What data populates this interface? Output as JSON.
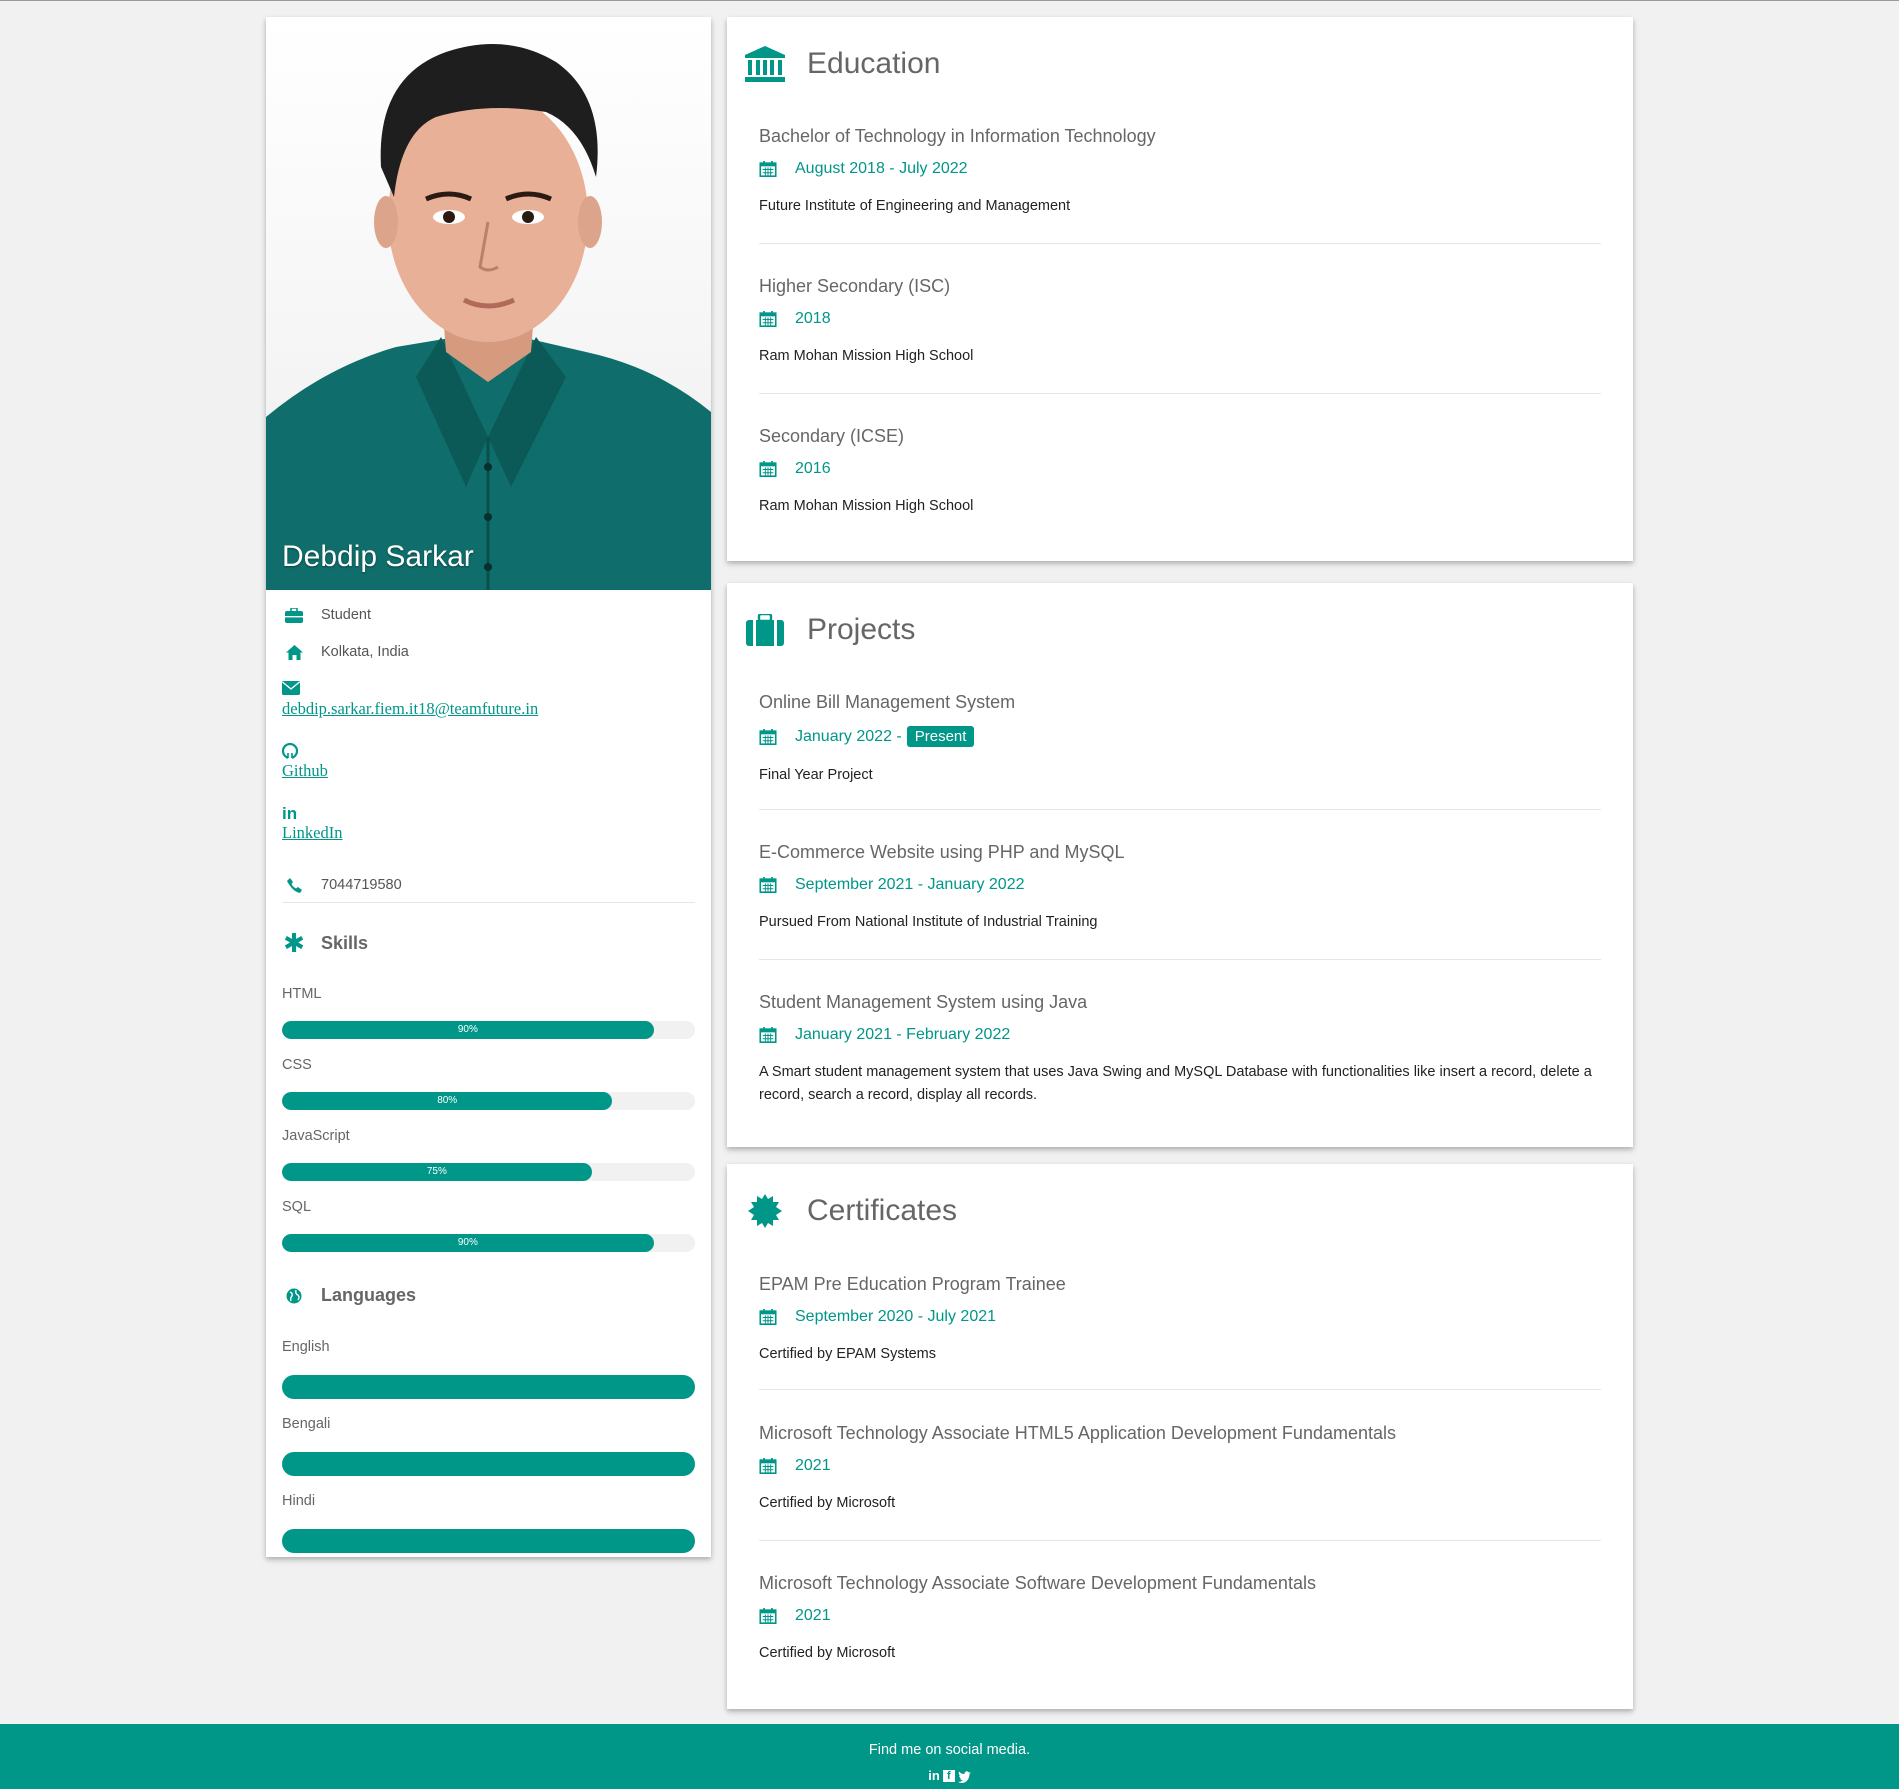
{
  "profile": {
    "name": "Debdip Sarkar",
    "role": "Student",
    "location": "Kolkata, India",
    "email": "debdip.sarkar.fiem.it18@teamfuture.in",
    "github": "Github",
    "linkedin": "LinkedIn",
    "phone": "7044719580"
  },
  "skills": {
    "heading": "Skills",
    "items": [
      {
        "name": "HTML",
        "percent": 90,
        "label": "90%"
      },
      {
        "name": "CSS",
        "percent": 80,
        "label": "80%"
      },
      {
        "name": "JavaScript",
        "percent": 75,
        "label": "75%"
      },
      {
        "name": "SQL",
        "percent": 90,
        "label": "90%"
      }
    ]
  },
  "languages": {
    "heading": "Languages",
    "items": [
      {
        "name": "English",
        "percent": 100
      },
      {
        "name": "Bengali",
        "percent": 100
      },
      {
        "name": "Hindi",
        "percent": 100
      }
    ]
  },
  "education": {
    "heading": "Education",
    "entries": [
      {
        "title": "Bachelor of Technology in Information Technology",
        "date": "August 2018 - July 2022",
        "desc": "Future Institute of Engineering and Management"
      },
      {
        "title": "Higher Secondary (ISC)",
        "date": "2018",
        "desc": "Ram Mohan Mission High School"
      },
      {
        "title": "Secondary (ICSE)",
        "date": "2016",
        "desc": "Ram Mohan Mission High School"
      }
    ]
  },
  "projects": {
    "heading": "Projects",
    "entries": [
      {
        "title": "Online Bill Management System",
        "date": "January 2022 -",
        "badge": "Present",
        "desc": "Final Year Project"
      },
      {
        "title": "E-Commerce Website using PHP and MySQL",
        "date": "September 2021 - January 2022",
        "desc": "Pursued From National Institute of Industrial Training"
      },
      {
        "title": "Student Management System using Java",
        "date": "January 2021 - February 2022",
        "desc": "A Smart student management system that uses Java Swing and MySQL Database with functionalities like insert a record, delete a record, search a record, display all records."
      }
    ]
  },
  "certificates": {
    "heading": "Certificates",
    "entries": [
      {
        "title": "EPAM Pre Education Program Trainee",
        "date": "September 2020 - July 2021",
        "desc": "Certified by EPAM Systems"
      },
      {
        "title": "Microsoft Technology Associate HTML5 Application Development Fundamentals",
        "date": "2021",
        "desc": "Certified by Microsoft"
      },
      {
        "title": "Microsoft Technology Associate Software Development Fundamentals",
        "date": "2021",
        "desc": "Certified by Microsoft"
      }
    ]
  },
  "footer": {
    "text": "Find me on social media.",
    "icons": [
      "linkedin-icon",
      "facebook-icon",
      "twitter-icon"
    ]
  },
  "colors": {
    "accent": "#009688",
    "background": "#f1f1f1"
  }
}
